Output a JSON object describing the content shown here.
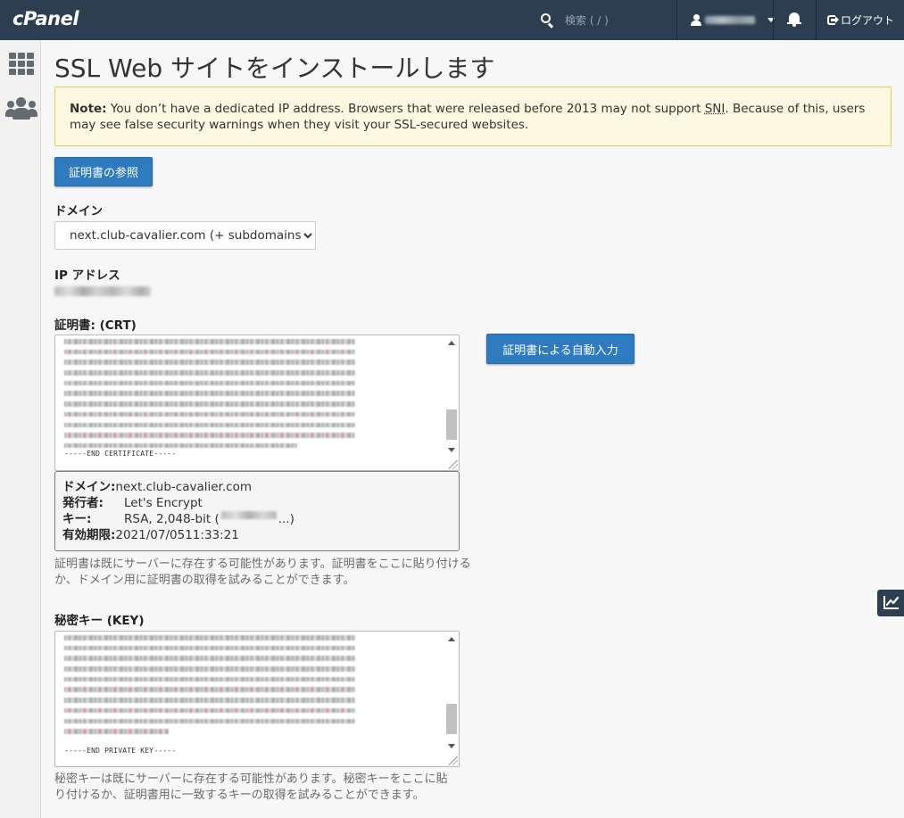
{
  "header": {
    "logo_text": "cPanel",
    "search_placeholder": "検索 ( / )",
    "logout_label": "ログアウト"
  },
  "page": {
    "title": "SSL Web サイトをインストールします"
  },
  "note": {
    "bold": "Note:",
    "text_before": " You don’t have a dedicated IP address. Browsers that were released before 2013 may not support ",
    "abbr": "SNI",
    "text_after": ". Because of this, users may see false security warnings when they visit your SSL-secured websites."
  },
  "buttons": {
    "browse_certificates": "証明書の参照",
    "autofill_by_certificate": "証明書による自動入力"
  },
  "domain": {
    "label": "ドメイン",
    "selected": "next.club-cavalier.com    (+ subdomains)"
  },
  "ip": {
    "label": "IP アドレス"
  },
  "certificate": {
    "label": "証明書: (CRT)",
    "end_marker": "-----END CERTIFICATE-----",
    "help": "証明書は既にサーバーに存在する可能性があります。証明書をここに貼り付けるか、ドメイン用に証明書の取得を試みることができます。"
  },
  "cert_info": {
    "domain_key": "ドメイン:",
    "domain_value": "next.club-cavalier.com",
    "issuer_key": "発行者:",
    "issuer_value": "Let's Encrypt",
    "key_key": "キー:",
    "key_value_prefix": "RSA, 2,048-bit (",
    "key_value_suffix": " ...)",
    "expiry_key": "有効期限:",
    "expiry_value": "2021/07/0511:33:21"
  },
  "private_key": {
    "label": "秘密キー (KEY)",
    "end_marker": "-----END PRIVATE KEY-----",
    "help": "秘密キーは既にサーバーに存在する可能性があります。秘密キーをここに貼り付けるか、証明書用に一致するキーの取得を試みることができます。"
  },
  "colors": {
    "topbar": "#2d3e50",
    "primary_button": "#2f7bbf",
    "note_background": "#fdf8e1",
    "note_border": "#e7c758"
  },
  "icons": [
    "search-icon",
    "user-icon",
    "chevron-down-icon",
    "bell-icon",
    "logout-icon",
    "apps-grid-icon",
    "users-icon",
    "line-chart-icon"
  ]
}
